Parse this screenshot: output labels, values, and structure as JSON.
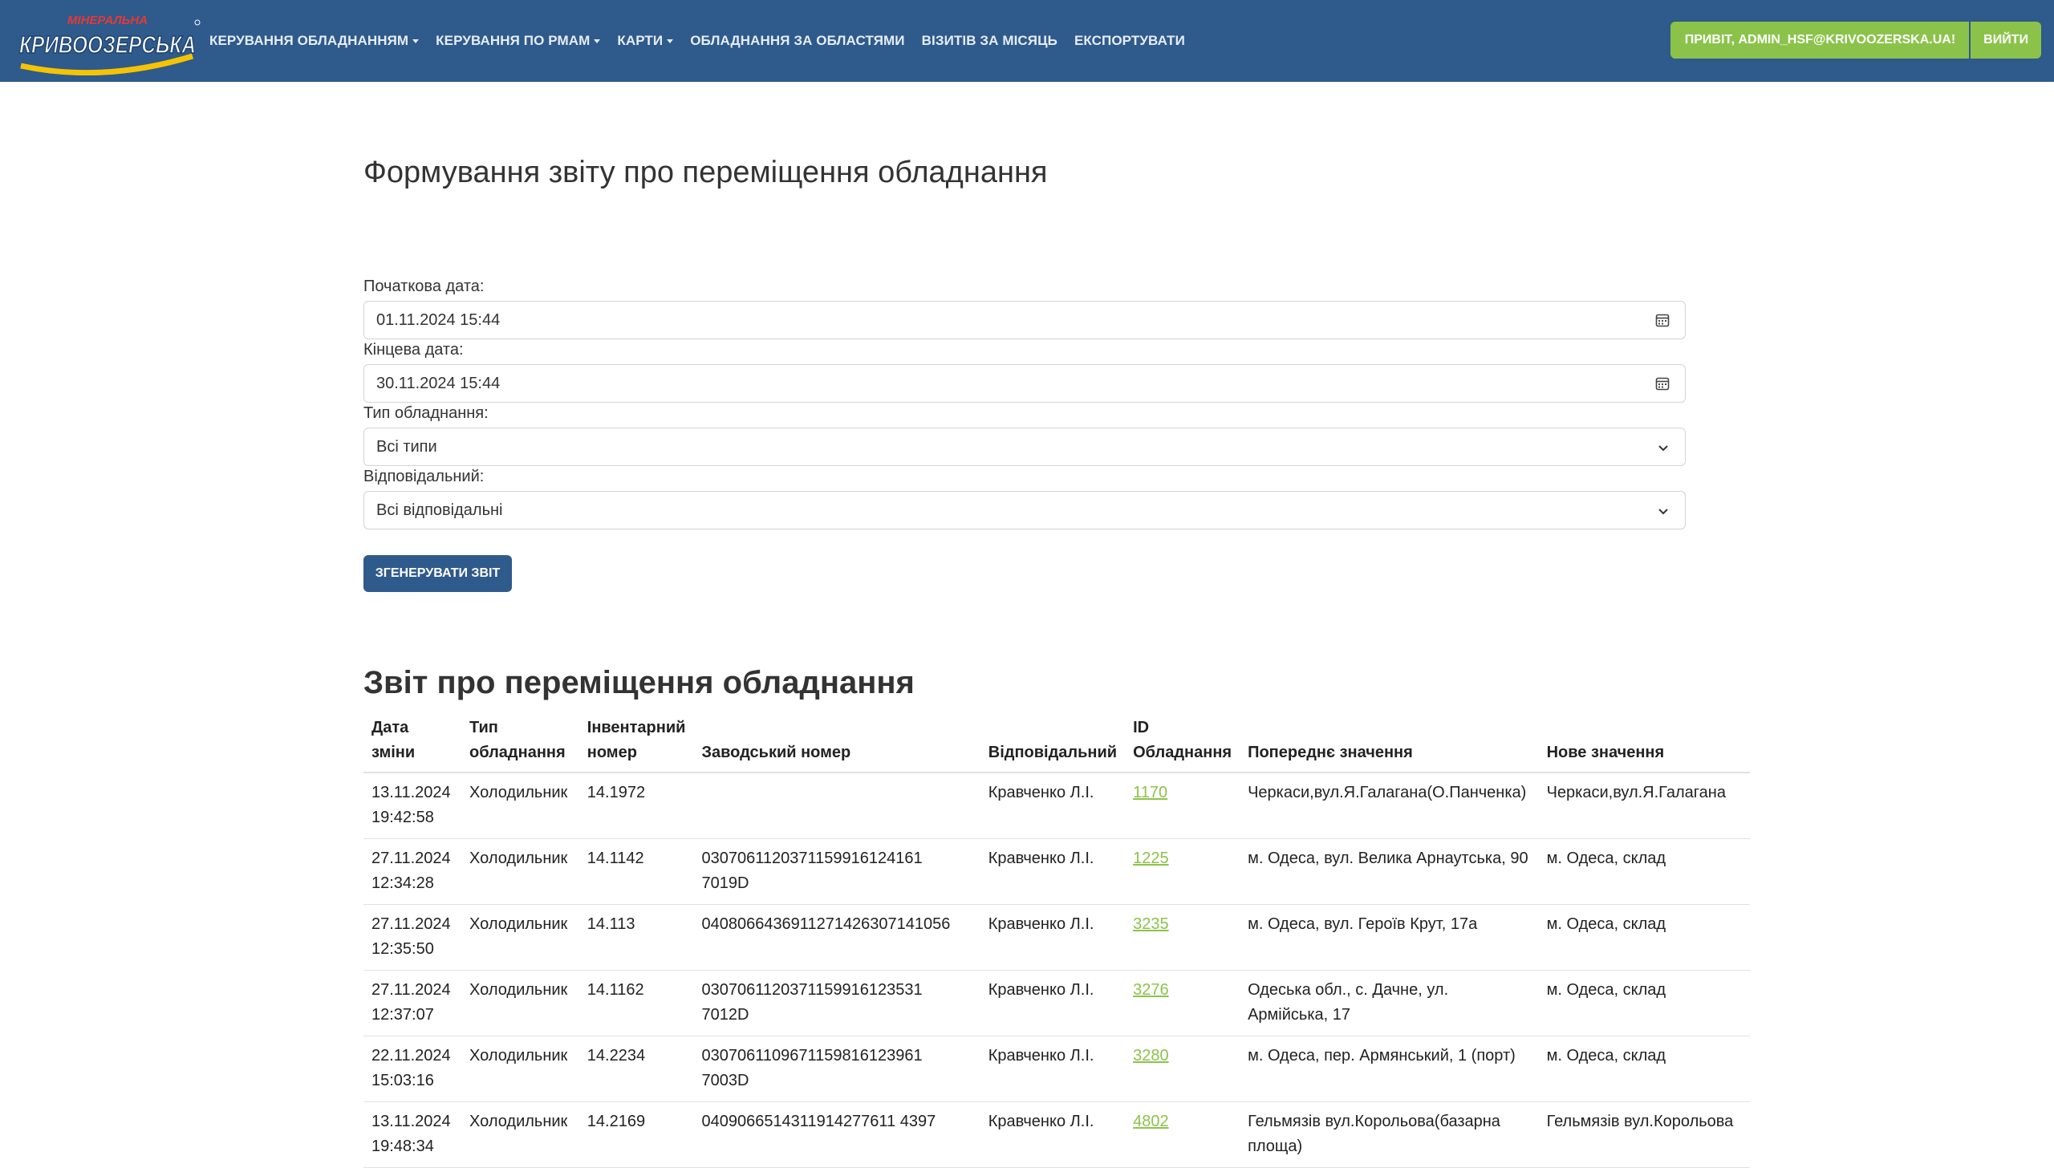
{
  "brand": {
    "logo_top": "МІНЕРАЛЬНА",
    "logo_main": "КРИВООЗЕРСЬКА",
    "colors": {
      "navbar": "#2f5a8c",
      "accent": "#8bc34a",
      "primary_button": "#2f5a8c"
    }
  },
  "nav": {
    "items": [
      {
        "label": "КЕРУВАННЯ ОБЛАДНАННЯМ",
        "dropdown": true
      },
      {
        "label": "КЕРУВАННЯ ПО РМАМ",
        "dropdown": true
      },
      {
        "label": "КАРТИ",
        "dropdown": true
      },
      {
        "label": "ОБЛАДНАННЯ ЗА ОБЛАСТЯМИ",
        "dropdown": false
      },
      {
        "label": "ВІЗИТІВ ЗА МІСЯЦЬ",
        "dropdown": false
      },
      {
        "label": "ЕКСПОРТУВАТИ",
        "dropdown": false
      }
    ],
    "greeting": "ПРИВІТ, ADMIN_HSF@KRIVOOZERSKA.UA!",
    "logout": "ВИЙТИ"
  },
  "form": {
    "title": "Формування звіту про переміщення обладнання",
    "start_label": "Початкова дата:",
    "start_value": "01.11.2024 15:44",
    "end_label": "Кінцева дата:",
    "end_value": "30.11.2024 15:44",
    "type_label": "Тип обладнання:",
    "type_value": "Всі типи",
    "responsible_label": "Відповідальний:",
    "responsible_value": "Всі відповідальні",
    "generate_button": "ЗГЕНЕРУВАТИ ЗВІТ"
  },
  "report": {
    "title": "Звіт про переміщення обладнання",
    "headers": [
      [
        "Дата",
        "зміни"
      ],
      [
        "Тип",
        "обладнання"
      ],
      [
        "Інвентарний",
        "номер"
      ],
      [
        "",
        "Заводський номер"
      ],
      [
        "",
        "Відповідальний"
      ],
      [
        "ID",
        "Обладнання"
      ],
      [
        "",
        "Попереднє значення"
      ],
      [
        "",
        "Нове значення"
      ]
    ],
    "rows": [
      {
        "date": "13.11.2024",
        "time": "19:42:58",
        "type": "Холодильник",
        "inv": "14.1972",
        "serial": "",
        "responsible": "Кравченко Л.І.",
        "id": "1170",
        "prev": "Черкаси,вул.Я.Галагана(О.Панченка)",
        "new": "Черкаси,вул.Я.Галагана"
      },
      {
        "date": "27.11.2024",
        "time": "12:34:28",
        "type": "Холодильник",
        "inv": "14.1142",
        "serial": "0307061120371159916124161 7019D",
        "responsible": "Кравченко Л.І.",
        "id": "1225",
        "prev": "м. Одеса, вул. Велика Арнаутська, 90",
        "new": "м. Одеса, склад"
      },
      {
        "date": "27.11.2024",
        "time": "12:35:50",
        "type": "Холодильник",
        "inv": "14.113",
        "serial": "0408066436911271426307141056",
        "responsible": "Кравченко Л.І.",
        "id": "3235",
        "prev": "м. Одеса, вул. Героїв Крут, 17а",
        "new": "м. Одеса, склад"
      },
      {
        "date": "27.11.2024",
        "time": "12:37:07",
        "type": "Холодильник",
        "inv": "14.1162",
        "serial": "0307061120371159916123531 7012D",
        "responsible": "Кравченко Л.І.",
        "id": "3276",
        "prev": "Одеська обл., с. Дачне, ул. Армійська, 17",
        "new": "м. Одеса, склад"
      },
      {
        "date": "22.11.2024",
        "time": "15:03:16",
        "type": "Холодильник",
        "inv": "14.2234",
        "serial": "0307061109671159816123961 7003D",
        "responsible": "Кравченко Л.І.",
        "id": "3280",
        "prev": "м. Одеса, пер. Армянський, 1 (порт)",
        "new": "м. Одеса, склад"
      },
      {
        "date": "13.11.2024",
        "time": "19:48:34",
        "type": "Холодильник",
        "inv": "14.2169",
        "serial": "0409066514311914277611 4397",
        "responsible": "Кравченко Л.І.",
        "id": "4802",
        "prev": "Гельмязів вул.Корольова(базарна площа)",
        "new": "Гельмязів вул.Корольова"
      }
    ]
  }
}
